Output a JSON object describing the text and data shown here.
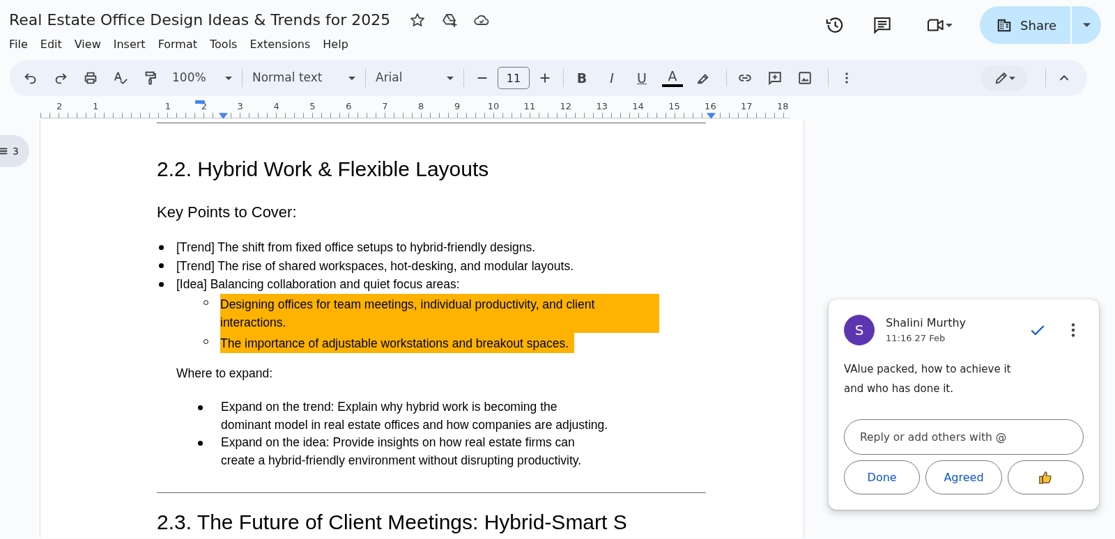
{
  "document": {
    "title": "Real Estate Office Design Ideas & Trends for 2025"
  },
  "menu": [
    "File",
    "Edit",
    "View",
    "Insert",
    "Format",
    "Tools",
    "Extensions",
    "Help"
  ],
  "share_button": {
    "label": "Share"
  },
  "toolbar": {
    "zoom": "100%",
    "paragraph_style": "Normal text",
    "font": "Arial",
    "font_size": "11",
    "format_buttons": [
      {
        "kind": "bold",
        "label": "B"
      },
      {
        "kind": "italic",
        "label": "I"
      },
      {
        "kind": "underline",
        "label": "U"
      },
      {
        "kind": "text-color",
        "label": "A"
      }
    ]
  },
  "ruler": {
    "left_labels": [
      "2",
      "1"
    ],
    "right_labels": [
      "1",
      "2",
      "3",
      "4",
      "5",
      "6",
      "7",
      "8",
      "9",
      "10",
      "11",
      "12",
      "13",
      "14",
      "15",
      "16",
      "17",
      "18"
    ]
  },
  "outline": {
    "count": "3"
  },
  "page": {
    "heading": "2.2. Hybrid Work & Flexible Layouts",
    "subheading": "Key Points to Cover:",
    "points": [
      {
        "text": "[Trend] The shift from fixed office setups to hybrid-friendly designs.",
        "highlighted": false
      },
      {
        "text": "[Trend] The rise of shared workspaces, hot-desking, and modular layouts.",
        "highlighted": false
      },
      {
        "text": "[Idea] Balancing collaboration and quiet focus areas:",
        "highlighted": false,
        "children": [
          {
            "text": "Designing offices for team meetings, individual productivity, and client interactions.",
            "highlighted": true
          },
          {
            "text": "The importance of adjustable workstations and breakout spaces.",
            "highlighted": true
          }
        ]
      }
    ],
    "expand_label": "Where to expand:",
    "expand_points": [
      "Expand on the trend: Explain why hybrid work is becoming the\ndominant model in real estate offices and how companies are adjusting.",
      "Expand on the idea: Provide insights on how real estate firms can\ncreate a hybrid-friendly environment without disrupting productivity."
    ],
    "next_heading": "2.3. The Future of Client Meetings: Hybrid-Smart S"
  },
  "comment": {
    "avatar_letter": "S",
    "author": "Shalini Murthy",
    "time": "11:16 27 Feb",
    "body": "VAlue packed, how to achieve it and who has done it.",
    "reply": {
      "placeholder": "Reply or add others with @"
    },
    "buttons": [
      "Done",
      "Agreed"
    ]
  }
}
